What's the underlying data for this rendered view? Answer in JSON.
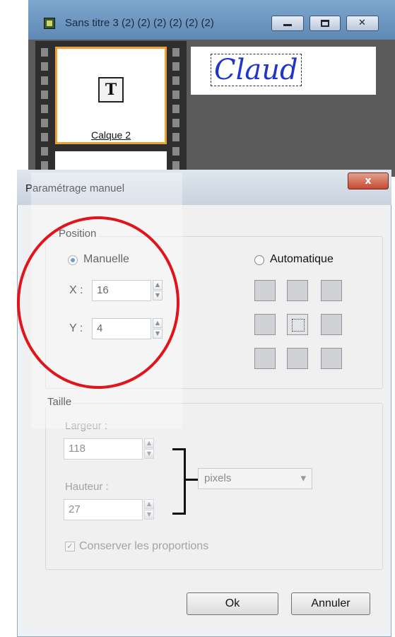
{
  "background_window": {
    "title": "Sans titre 3 (2) (2) (2) (2) (2) (2)",
    "layer_label": "Calque 2",
    "preview_text": "Claud"
  },
  "dialog": {
    "title": "Paramétrage manuel",
    "close_label": "x",
    "position": {
      "label": "Position",
      "manual_label": "Manuelle",
      "auto_label": "Automatique",
      "x_label": "X :",
      "x_value": "16",
      "y_label": "Y :",
      "y_value": "4",
      "selected_mode": "Manuelle"
    },
    "size": {
      "label": "Taille",
      "width_label": "Largeur :",
      "width_value": "118",
      "height_label": "Hauteur :",
      "height_value": "27",
      "unit_value": "pixels",
      "keep_ratio_label": "Conserver les proportions",
      "keep_ratio_checked": true
    },
    "buttons": {
      "ok": "Ok",
      "cancel": "Annuler"
    }
  },
  "icons": {
    "app": "film-icon",
    "layer": "text-layer-icon",
    "minimize": "minimize-icon",
    "maximize": "maximize-icon",
    "close": "close-icon",
    "spin_up": "▲",
    "spin_down": "▼",
    "check": "✓",
    "dropdown": "▾"
  },
  "colors": {
    "highlight_ellipse": "#e0151b",
    "accent_radio": "#2a63b8",
    "preview_text": "#2036c8"
  }
}
